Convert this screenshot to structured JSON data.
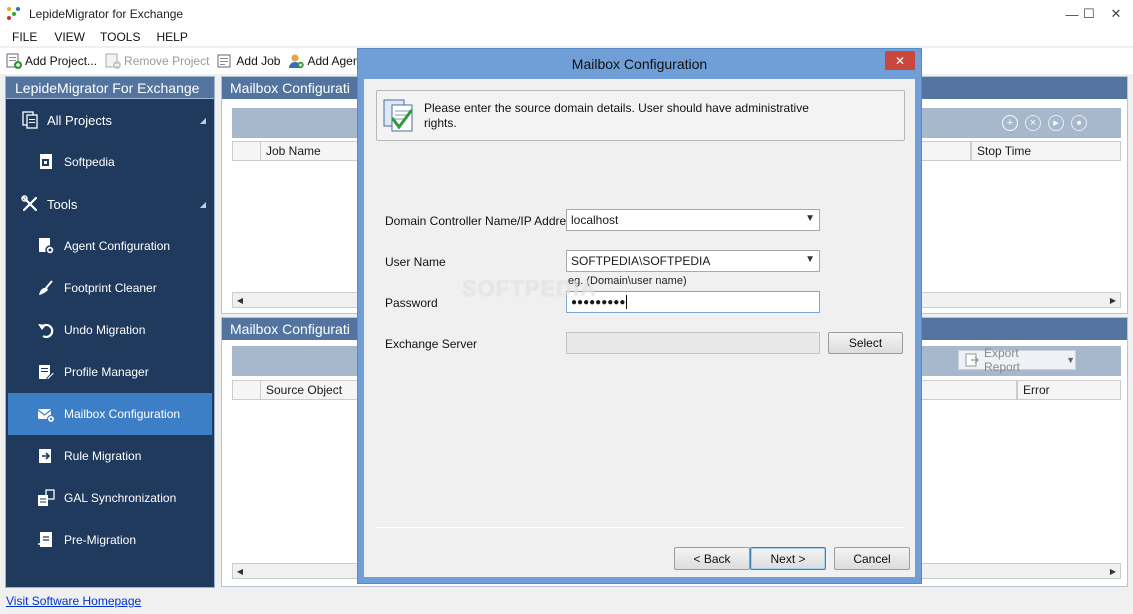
{
  "window": {
    "title": "LepideMigrator for Exchange",
    "minimize": "—",
    "maximize": "☐",
    "close": "✕"
  },
  "menu": [
    "FILE",
    "VIEW",
    "TOOLS",
    "HELP"
  ],
  "toolbar": {
    "add_project": "Add Project...",
    "remove_project": "Remove Project",
    "add_job": "Add Job",
    "add_agent": "Add Agen"
  },
  "sidebar": {
    "header": "LepideMigrator For Exchange",
    "all_projects": "All Projects",
    "project_item": "Softpedia",
    "tools": "Tools",
    "items": [
      {
        "label": "Agent Configuration",
        "icon": "agent-config-icon"
      },
      {
        "label": "Footprint Cleaner",
        "icon": "broom-icon"
      },
      {
        "label": "Undo Migration",
        "icon": "undo-icon"
      },
      {
        "label": "Profile Manager",
        "icon": "profile-icon"
      },
      {
        "label": "Mailbox Configuration",
        "icon": "mailbox-config-icon"
      },
      {
        "label": "Rule Migration",
        "icon": "rule-icon"
      },
      {
        "label": "GAL Synchronization",
        "icon": "gal-sync-icon"
      },
      {
        "label": "Pre-Migration",
        "icon": "pre-migration-icon"
      }
    ]
  },
  "panel_top": {
    "title": "Mailbox Configurati",
    "columns": [
      "Job Name",
      "Stop Time"
    ]
  },
  "panel_bottom": {
    "title": "Mailbox Configurati",
    "columns": [
      "Source Object",
      "Error"
    ],
    "export_report": "Export Report"
  },
  "footer": {
    "link": "Visit Software Homepage"
  },
  "dialog": {
    "title": "Mailbox Configuration",
    "close": "✕",
    "info": "Please enter the source domain details. User should have administrative rights.",
    "domain_label": "Domain Controller Name/IP Address",
    "domain_value": "localhost",
    "user_label": "User Name",
    "user_value": "SOFTPEDIA\\SOFTPEDIA",
    "user_hint": "eg. (Domain\\user name)",
    "password_label": "Password",
    "password_value": "●●●●●●●●●",
    "exchange_label": "Exchange Server",
    "exchange_value": "",
    "select": "Select",
    "back": "< Back",
    "next": "Next >",
    "cancel": "Cancel",
    "watermark": "SOFTPEDIA"
  },
  "colors": {
    "sidebar_bg": "#1f3a5c",
    "header_blue": "#5474a0",
    "active_item": "#3d7fc6",
    "dialog_frame": "#6f9fd6",
    "close_red": "#c9463d"
  }
}
